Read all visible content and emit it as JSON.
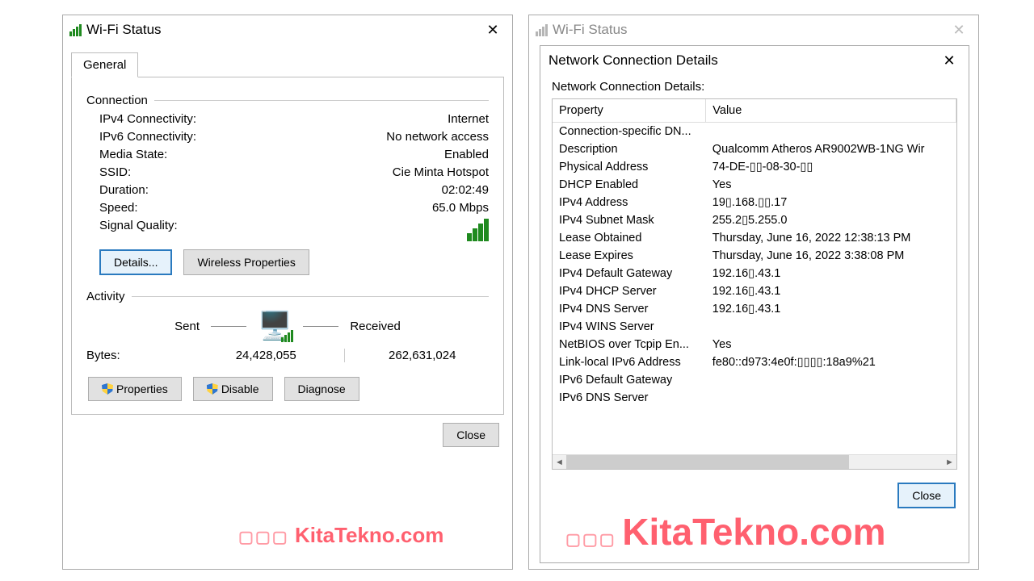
{
  "watermark": "KitaTekno.com",
  "left": {
    "title": "Wi-Fi Status",
    "tab": "General",
    "connection_legend": "Connection",
    "activity_legend": "Activity",
    "connection": [
      {
        "label": "IPv4 Connectivity:",
        "value": "Internet"
      },
      {
        "label": "IPv6 Connectivity:",
        "value": "No network access"
      },
      {
        "label": "Media State:",
        "value": "Enabled"
      },
      {
        "label": "SSID:",
        "value": "Cie Minta Hotspot"
      },
      {
        "label": "Duration:",
        "value": "02:02:49"
      },
      {
        "label": "Speed:",
        "value": "65.0 Mbps"
      }
    ],
    "signal_quality_label": "Signal Quality:",
    "details_btn": "Details...",
    "wireless_properties_btn": "Wireless Properties",
    "activity": {
      "sent_label": "Sent",
      "received_label": "Received",
      "bytes_label": "Bytes:",
      "sent_bytes": "24,428,055",
      "received_bytes": "262,631,024"
    },
    "properties_btn": "Properties",
    "disable_btn": "Disable",
    "diagnose_btn": "Diagnose",
    "close_btn": "Close"
  },
  "bg_right_title": "Wi-Fi Status",
  "ncd": {
    "title": "Network Connection Details",
    "label": "Network Connection Details:",
    "property_header": "Property",
    "value_header": "Value",
    "rows": [
      {
        "prop": "Connection-specific DN...",
        "value": ""
      },
      {
        "prop": "Description",
        "value": "Qualcomm Atheros AR9002WB-1NG Wir"
      },
      {
        "prop": "Physical Address",
        "value": "74-DE-▯▯-08-30-▯▯"
      },
      {
        "prop": "DHCP Enabled",
        "value": "Yes"
      },
      {
        "prop": "IPv4 Address",
        "value": "19▯.168.▯▯.17"
      },
      {
        "prop": "IPv4 Subnet Mask",
        "value": "255.2▯5.255.0"
      },
      {
        "prop": "Lease Obtained",
        "value": "Thursday, June 16, 2022 12:38:13 PM"
      },
      {
        "prop": "Lease Expires",
        "value": "Thursday, June 16, 2022 3:38:08 PM"
      },
      {
        "prop": "IPv4 Default Gateway",
        "value": "192.16▯.43.1"
      },
      {
        "prop": "IPv4 DHCP Server",
        "value": "192.16▯.43.1"
      },
      {
        "prop": "IPv4 DNS Server",
        "value": "192.16▯.43.1"
      },
      {
        "prop": "IPv4 WINS Server",
        "value": ""
      },
      {
        "prop": "NetBIOS over Tcpip En...",
        "value": "Yes"
      },
      {
        "prop": "Link-local IPv6 Address",
        "value": "fe80::d973:4e0f:▯▯▯▯:18a9%21"
      },
      {
        "prop": "IPv6 Default Gateway",
        "value": ""
      },
      {
        "prop": "IPv6 DNS Server",
        "value": ""
      }
    ],
    "close_btn": "Close"
  }
}
